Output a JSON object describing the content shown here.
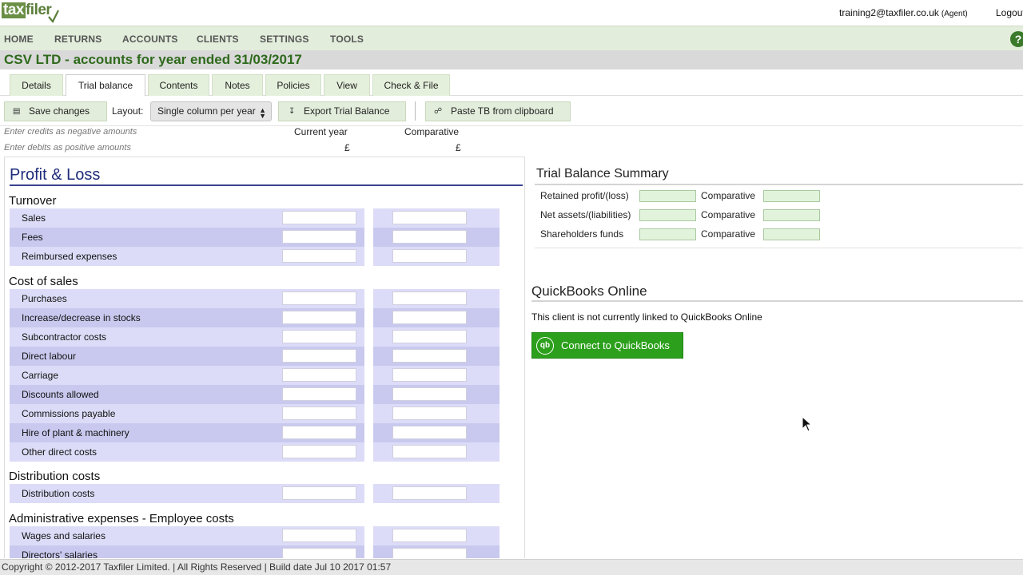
{
  "header": {
    "logo_tax": "tax",
    "logo_filer": "filer",
    "user_email": "training2@taxfiler.co.uk",
    "user_role": "(Agent)",
    "logout": "Logout"
  },
  "nav": {
    "items": [
      "HOME",
      "RETURNS",
      "ACCOUNTS",
      "CLIENTS",
      "SETTINGS",
      "TOOLS"
    ],
    "help": "?"
  },
  "page_title": "CSV LTD - accounts for year ended 31/03/2017",
  "tabs": [
    "Details",
    "Trial balance",
    "Contents",
    "Notes",
    "Policies",
    "View",
    "Check & File"
  ],
  "active_tab": "Trial balance",
  "toolbar": {
    "save_label": "Save changes",
    "layout_label": "Layout:",
    "layout_value": "Single column per year",
    "export_label": "Export Trial Balance",
    "paste_label": "Paste TB from clipboard"
  },
  "hints": {
    "credits": "Enter credits as negative amounts",
    "debits": "Enter debits as positive amounts"
  },
  "columns": {
    "current": "Current year",
    "comparative": "Comparative",
    "currency": "£"
  },
  "profit_loss": {
    "title": "Profit & Loss",
    "sections": [
      {
        "heading": "Turnover",
        "rows": [
          "Sales",
          "Fees",
          "Reimbursed expenses"
        ]
      },
      {
        "heading": "Cost of sales",
        "rows": [
          "Purchases",
          "Increase/decrease in stocks",
          "Subcontractor costs",
          "Direct labour",
          "Carriage",
          "Discounts allowed",
          "Commissions payable",
          "Hire of plant & machinery",
          "Other direct costs"
        ]
      },
      {
        "heading": "Distribution costs",
        "rows": [
          "Distribution costs"
        ]
      },
      {
        "heading": "Administrative expenses - Employee costs",
        "rows": [
          "Wages and salaries",
          "Directors' salaries"
        ]
      }
    ]
  },
  "tb_summary": {
    "title": "Trial Balance Summary",
    "rows": [
      "Retained profit/(loss)",
      "Net assets/(liabilities)",
      "Shareholders funds"
    ],
    "comparative_label": "Comparative"
  },
  "quickbooks": {
    "title": "QuickBooks Online",
    "status": "This client is not currently linked to QuickBooks Online",
    "button": "Connect to QuickBooks",
    "icon_text": "qb"
  },
  "footer": "Copyright © 2012-2017 Taxfiler Limited. | All Rights Reserved | Build date Jul 10 2017 01:57"
}
